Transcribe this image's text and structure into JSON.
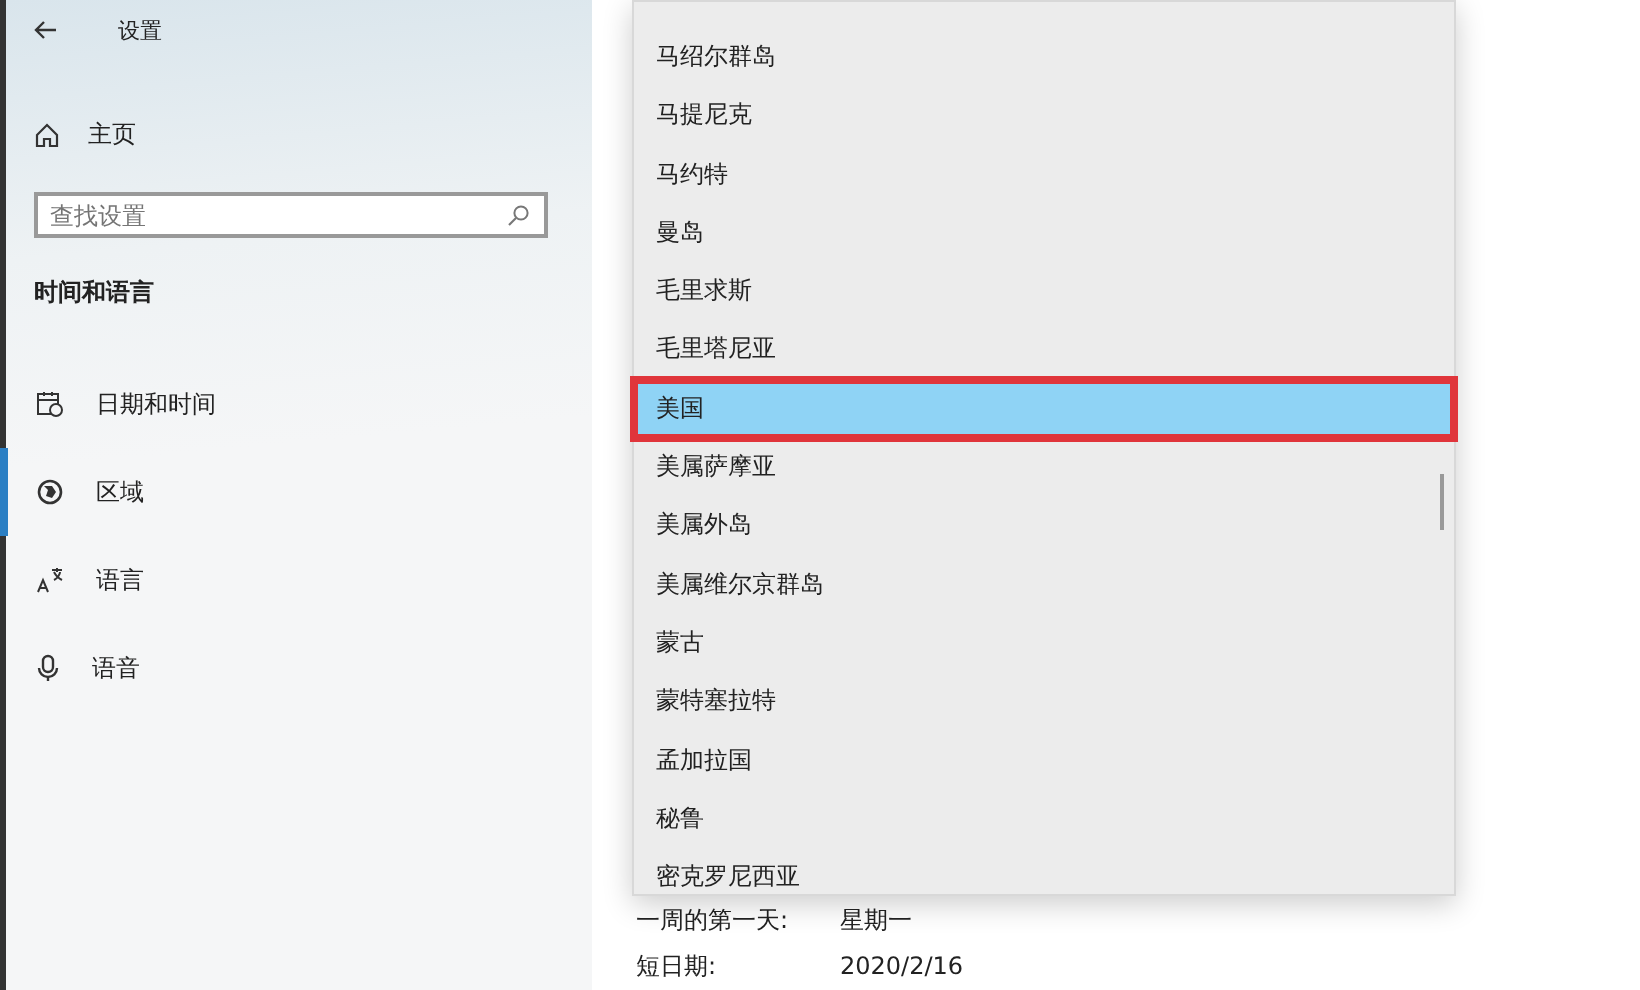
{
  "window": {
    "title": "设置"
  },
  "sidebar": {
    "home": "主页",
    "search": {
      "placeholder": "查找设置"
    },
    "section": "时间和语言",
    "items": [
      {
        "label": "日期和时间",
        "selected": false
      },
      {
        "label": "区域",
        "selected": true
      },
      {
        "label": "语言",
        "selected": false
      },
      {
        "label": "语音",
        "selected": false
      }
    ]
  },
  "dropdown": {
    "options": [
      {
        "label": "马绍尔群岛",
        "selected": false,
        "outlined": false
      },
      {
        "label": "马提尼克",
        "selected": false,
        "outlined": false
      },
      {
        "label": "马约特",
        "selected": false,
        "outlined": false
      },
      {
        "label": "曼岛",
        "selected": false,
        "outlined": false
      },
      {
        "label": "毛里求斯",
        "selected": false,
        "outlined": false
      },
      {
        "label": "毛里塔尼亚",
        "selected": false,
        "outlined": false
      },
      {
        "label": "美国",
        "selected": true,
        "outlined": true
      },
      {
        "label": "美属萨摩亚",
        "selected": false,
        "outlined": false
      },
      {
        "label": "美属外岛",
        "selected": false,
        "outlined": false
      },
      {
        "label": "美属维尔京群岛",
        "selected": false,
        "outlined": false
      },
      {
        "label": "蒙古",
        "selected": false,
        "outlined": false
      },
      {
        "label": "蒙特塞拉特",
        "selected": false,
        "outlined": false
      },
      {
        "label": "孟加拉国",
        "selected": false,
        "outlined": false
      },
      {
        "label": "秘鲁",
        "selected": false,
        "outlined": false
      },
      {
        "label": "密克罗尼西亚",
        "selected": false,
        "outlined": false
      }
    ]
  },
  "formats": [
    {
      "label": "一周的第一天:",
      "value": "星期一"
    },
    {
      "label": "短日期:",
      "value": "2020/2/16"
    }
  ]
}
